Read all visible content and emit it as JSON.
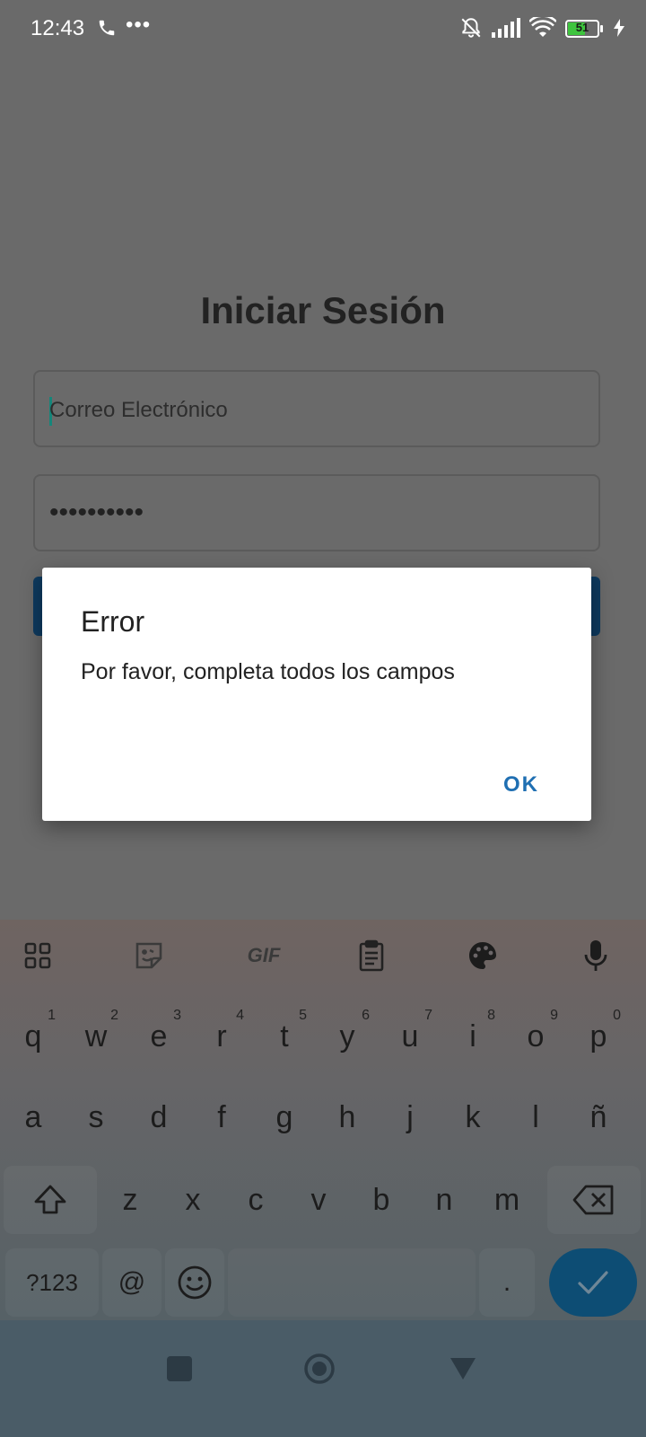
{
  "status_bar": {
    "time": "12:43",
    "battery": "51"
  },
  "login": {
    "title": "Iniciar Sesión",
    "email_placeholder": "Correo Electrónico",
    "password_value": "••••••••••"
  },
  "dialog": {
    "title": "Error",
    "message": "Por favor, completa todos los campos",
    "ok_label": "OK"
  },
  "keyboard": {
    "toolbar": [
      {
        "name": "apps-grid-icon"
      },
      {
        "name": "sticker-icon"
      },
      {
        "name": "gif-icon",
        "label": "GIF"
      },
      {
        "name": "clipboard-icon"
      },
      {
        "name": "palette-icon"
      },
      {
        "name": "mic-icon"
      }
    ],
    "row1": [
      "q",
      "w",
      "e",
      "r",
      "t",
      "y",
      "u",
      "i",
      "o",
      "p"
    ],
    "row1_sup": [
      "1",
      "2",
      "3",
      "4",
      "5",
      "6",
      "7",
      "8",
      "9",
      "0"
    ],
    "row2": [
      "a",
      "s",
      "d",
      "f",
      "g",
      "h",
      "j",
      "k",
      "l",
      "ñ"
    ],
    "row3": [
      "z",
      "x",
      "c",
      "v",
      "b",
      "n",
      "m"
    ],
    "row4": {
      "symbols_label": "?123",
      "at_label": "@",
      "period_label": "."
    }
  },
  "colors": {
    "accent": "#1f6fb2",
    "enter_key": "#0d4d74",
    "cursor": "#16867a"
  }
}
